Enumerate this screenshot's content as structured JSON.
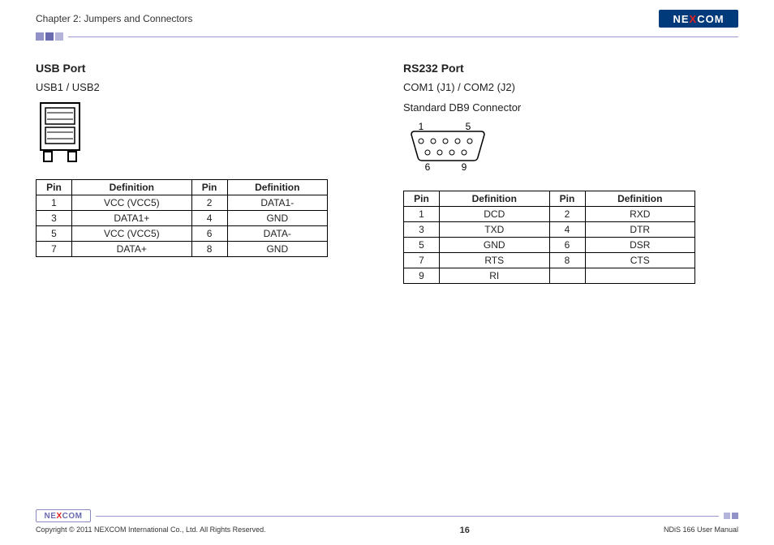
{
  "header": {
    "chapter": "Chapter 2: Jumpers and Connectors",
    "logo_pre": "NE",
    "logo_x": "X",
    "logo_post": "COM"
  },
  "usb": {
    "title": "USB Port",
    "sub": "USB1 / USB2",
    "th_pin": "Pin",
    "th_def": "Definition",
    "rows": [
      {
        "p1": "1",
        "d1": "VCC (VCC5)",
        "p2": "2",
        "d2": "DATA1-"
      },
      {
        "p1": "3",
        "d1": "DATA1+",
        "p2": "4",
        "d2": "GND"
      },
      {
        "p1": "5",
        "d1": "VCC (VCC5)",
        "p2": "6",
        "d2": "DATA-"
      },
      {
        "p1": "7",
        "d1": "DATA+",
        "p2": "8",
        "d2": "GND"
      }
    ]
  },
  "rs232": {
    "title": "RS232 Port",
    "sub1": "COM1 (J1) / COM2 (J2)",
    "sub2": "Standard DB9 Connector",
    "label_1": "1",
    "label_5": "5",
    "label_6": "6",
    "label_9": "9",
    "th_pin": "Pin",
    "th_def": "Definition",
    "rows": [
      {
        "p1": "1",
        "d1": "DCD",
        "p2": "2",
        "d2": "RXD"
      },
      {
        "p1": "3",
        "d1": "TXD",
        "p2": "4",
        "d2": "DTR"
      },
      {
        "p1": "5",
        "d1": "GND",
        "p2": "6",
        "d2": "DSR"
      },
      {
        "p1": "7",
        "d1": "RTS",
        "p2": "8",
        "d2": "CTS"
      },
      {
        "p1": "9",
        "d1": "RI",
        "p2": "",
        "d2": ""
      }
    ]
  },
  "footer": {
    "logo_pre": "NE",
    "logo_x": "X",
    "logo_post": "COM",
    "copyright": "Copyright © 2011 NEXCOM International Co., Ltd. All Rights Reserved.",
    "page": "16",
    "manual": "NDiS 166 User Manual"
  },
  "chart_data": [
    {
      "type": "table",
      "title": "USB Port Pinout (USB1 / USB2)",
      "columns": [
        "Pin",
        "Definition"
      ],
      "rows": [
        [
          1,
          "VCC (VCC5)"
        ],
        [
          2,
          "DATA1-"
        ],
        [
          3,
          "DATA1+"
        ],
        [
          4,
          "GND"
        ],
        [
          5,
          "VCC (VCC5)"
        ],
        [
          6,
          "DATA-"
        ],
        [
          7,
          "DATA+"
        ],
        [
          8,
          "GND"
        ]
      ]
    },
    {
      "type": "table",
      "title": "RS232 Port Pinout (COM1 J1 / COM2 J2, Standard DB9)",
      "columns": [
        "Pin",
        "Definition"
      ],
      "rows": [
        [
          1,
          "DCD"
        ],
        [
          2,
          "RXD"
        ],
        [
          3,
          "TXD"
        ],
        [
          4,
          "DTR"
        ],
        [
          5,
          "GND"
        ],
        [
          6,
          "DSR"
        ],
        [
          7,
          "RTS"
        ],
        [
          8,
          "CTS"
        ],
        [
          9,
          "RI"
        ]
      ]
    }
  ]
}
